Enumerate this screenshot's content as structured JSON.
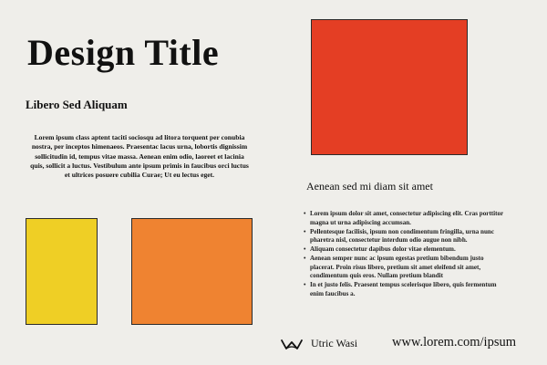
{
  "title": "Design Title",
  "subtitle": "Libero Sed Aliquam",
  "body_text": "Lorem ipsum class aptent taciti sociosqu ad litora torquent per conubia nostra, per inceptos himenaeos. Praesentac lacus urna, lobortis dignissim sollicitudin id, tempus vitae massa. Aenean enim odio, laoreet et lacinia quis, sollicit a luctus. Vestibulum ante ipsum primis in faucibus orci luctus et ultrices posuere cubilia Curae; Ut eu lectus eget.",
  "section_heading": "Aenean sed mi diam sit amet",
  "bullets": [
    "Lorem ipsum dolor sit amet, consectetur adipiscing elit. Cras porttitor magna ut urna adipiscing accumsan.",
    "Pellentesque facilisis, ipsum non condimentum fringilla, urna nunc pharetra nisl, consectetur interdum odio augue non nibh.",
    "Aliquam consectetur dapibus dolor vitae elementum.",
    "Aenean semper nunc ac ipsum egestas pretium bibendum justo placerat. Proin risus libero, pretium sit amet eleifend sit amet, condimentum quis eros. Nullam pretium blandit",
    "In et justo felis. Praesent tempus scelerisque libero, quis fermentum enim faucibus a."
  ],
  "brand_name": "Utric Wasi",
  "brand_icon": "crown-wave-logo-icon",
  "url": "www.lorem.com/ipsum",
  "colors": {
    "background": "#efeeea",
    "swatch_yellow": "#efcf25",
    "swatch_orange": "#ef8331",
    "swatch_red": "#e43e24"
  }
}
